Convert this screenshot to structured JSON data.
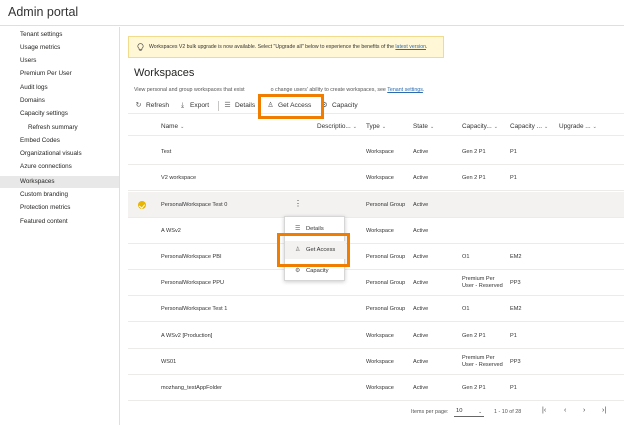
{
  "app": {
    "title": "Admin portal"
  },
  "sidebar": {
    "items": [
      {
        "label": "Tenant settings"
      },
      {
        "label": "Usage metrics"
      },
      {
        "label": "Users"
      },
      {
        "label": "Premium Per User"
      },
      {
        "label": "Audit logs"
      },
      {
        "label": "Domains"
      },
      {
        "label": "Capacity settings"
      },
      {
        "label": "Refresh summary"
      },
      {
        "label": "Embed Codes"
      },
      {
        "label": "Organizational visuals"
      },
      {
        "label": "Azure connections"
      },
      {
        "label": "Workspaces"
      },
      {
        "label": "Custom branding"
      },
      {
        "label": "Protection metrics"
      },
      {
        "label": "Featured content"
      }
    ],
    "active": "Workspaces"
  },
  "banner": {
    "text": "Workspaces V2 bulk upgrade is now available. Select \"Upgrade all\" below to experience the benefits of the ",
    "link": "latest version",
    "suffix": ".",
    "icon": "lightbulb-icon"
  },
  "page": {
    "title": "Workspaces",
    "description_before": "View personal and group workspaces that exist",
    "description_after": "o change users' ability to create workspaces, see ",
    "description_link": "Tenant settings",
    "description_end": "."
  },
  "toolbar": {
    "refresh": "Refresh",
    "export": "Export",
    "details": "Details",
    "get_access": "Get Access",
    "capacity": "Capacity"
  },
  "table": {
    "columns": {
      "name": "Name",
      "description": "Descriptio...",
      "type": "Type",
      "state": "State",
      "capacity_name": "Capacity...",
      "capacity_sku": "Capacity ...",
      "upgrade": "Upgrade ..."
    },
    "rows": [
      {
        "name": "Test",
        "type": "Workspace",
        "state": "Active",
        "cap": "Gen 2 P1",
        "sku": "P1"
      },
      {
        "name": "V2 workspace",
        "type": "Workspace",
        "state": "Active",
        "cap": "Gen 2 P1",
        "sku": "P1"
      },
      {
        "name": "PersonalWorkspace Test 0",
        "type": "Personal Group",
        "state": "Active",
        "cap": "",
        "sku": ""
      },
      {
        "name": "A WSv2",
        "type": "Workspace",
        "state": "Active",
        "cap": "",
        "sku": ""
      },
      {
        "name": "PersonalWorkspace PBI",
        "type": "Personal Group",
        "state": "Active",
        "cap": "O1",
        "sku": "EM2"
      },
      {
        "name": "PersonalWorkspace PPU",
        "type": "Personal Group",
        "state": "Active",
        "cap": "Premium Per User - Reserved",
        "sku": "PP3"
      },
      {
        "name": "PersonalWorkspace Test 1",
        "type": "Personal Group",
        "state": "Active",
        "cap": "O1",
        "sku": "EM2"
      },
      {
        "name": "A WSv2 [Production]",
        "type": "Workspace",
        "state": "Active",
        "cap": "Gen 2 P1",
        "sku": "P1"
      },
      {
        "name": "WS01",
        "type": "Workspace",
        "state": "Active",
        "cap": "Premium Per User - Reserved",
        "sku": "PP3"
      },
      {
        "name": "mozhang_testAppFolder",
        "type": "Workspace",
        "state": "Active",
        "cap": "Gen 2 P1",
        "sku": "P1"
      }
    ],
    "selected_row": "PersonalWorkspace Test 0"
  },
  "context_menu": {
    "details": "Details",
    "get_access": "Get Access",
    "capacity": "Capacity"
  },
  "pager": {
    "items_per_page_label": "Items per page:",
    "items_per_page_value": "10",
    "range": "1 - 10 of 28"
  },
  "colors": {
    "highlight": "#f07c00",
    "selected_check": "#e8b500",
    "banner_bg": "#fff7d6",
    "link": "#2b6cb0"
  }
}
